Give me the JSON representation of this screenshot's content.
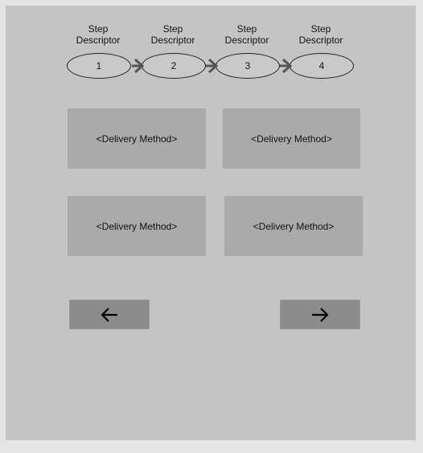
{
  "steps": [
    {
      "descriptor": "Step\nDescriptor",
      "number": "1"
    },
    {
      "descriptor": "Step\nDescriptor",
      "number": "2"
    },
    {
      "descriptor": "Step\nDescriptor",
      "number": "3"
    },
    {
      "descriptor": "Step\nDescriptor",
      "number": "4"
    }
  ],
  "delivery_methods": [
    "<Delivery Method>",
    "<Delivery Method>",
    "<Delivery Method>",
    "<Delivery Method>"
  ],
  "nav": {
    "back_icon": "arrow-left-icon",
    "next_icon": "arrow-right-icon"
  }
}
